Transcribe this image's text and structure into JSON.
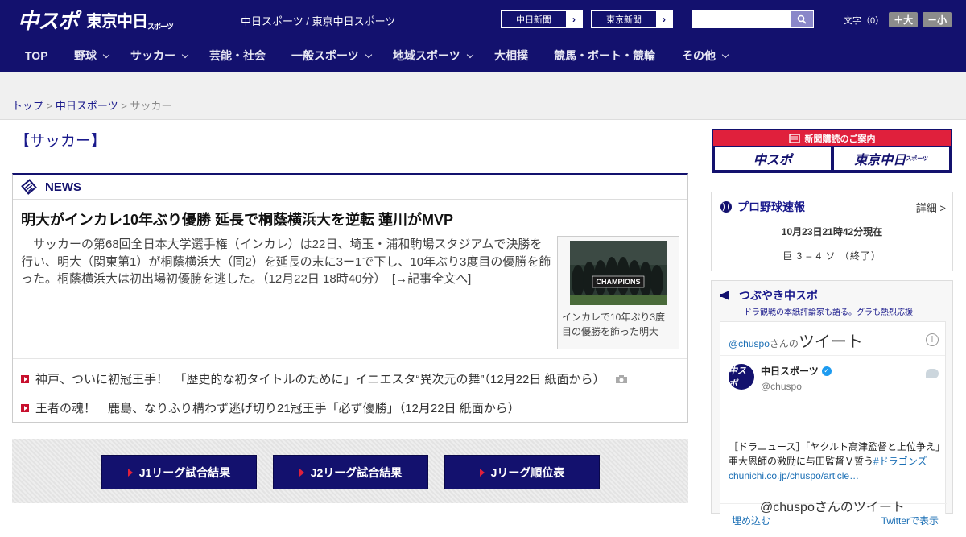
{
  "header": {
    "logo_main": "中スポ",
    "logo_tokyo": "東京中日",
    "logo_tokyo_small": "スポーツ",
    "site_title": "中日スポーツ / 東京中日スポーツ",
    "ext_links": [
      {
        "label": "中日新聞",
        "arrow": "›"
      },
      {
        "label": "東京新聞",
        "arrow": "›"
      }
    ],
    "search": {
      "placeholder": "",
      "value": "",
      "icon": "search-icon"
    },
    "font_size": {
      "label": "文字（0）",
      "bigger": "＋大",
      "smaller": "－小"
    }
  },
  "nav": {
    "items": [
      {
        "label": "TOP",
        "has_dropdown": false
      },
      {
        "label": "野球",
        "has_dropdown": true
      },
      {
        "label": "サッカー",
        "has_dropdown": true
      },
      {
        "label": "芸能・社会",
        "has_dropdown": false
      },
      {
        "label": "一般スポーツ",
        "has_dropdown": true
      },
      {
        "label": "地域スポーツ",
        "has_dropdown": true
      },
      {
        "label": "大相撲",
        "has_dropdown": false
      },
      {
        "label": "競馬・ボート・競輪",
        "has_dropdown": false
      },
      {
        "label": "その他",
        "has_dropdown": true
      }
    ]
  },
  "breadcrumb": {
    "items": [
      "トップ",
      "中日スポーツ",
      "サッカー"
    ],
    "separator": ">"
  },
  "page_title": "【サッカー】",
  "news": {
    "heading": "NEWS",
    "headline": "明大がインカレ10年ぶり優勝 延長で桐蔭横浜大を逆転 蓮川がMVP",
    "lead": "サッカーの第68回全日本大学選手権（インカレ）は22日、埼玉・浦和駒場スタジアムで決勝を行い、明大（関東第1）が桐蔭横浜大（同2）を延長の末に3ー1で下し、10年ぶり3度目の優勝を飾った。桐蔭横浜大は初出場初優勝を逃した。（12月22日 18時40分）　[→記事全文へ]",
    "photo_caption": "インカレで10年ぶり3度目の優勝を飾った明大",
    "photo_banner": "CHAMPIONS",
    "sub_items": [
      {
        "text": "神戸、ついに初冠王手！　「歴史的な初タイトルのために」イニエスタ“異次元の舞”（12月22日 紙面から）",
        "has_photo_icon": true
      },
      {
        "text": "王者の魂！　鹿島、なりふり構わず逃げ切り21冠王手「必ず優勝」（12月22日 紙面から）",
        "has_photo_icon": false
      }
    ]
  },
  "jleague_buttons": [
    "J1リーグ試合結果",
    "J2リーグ試合結果",
    "Jリーグ順位表"
  ],
  "sidebar": {
    "subscribe": {
      "title": "新聞購読のご案内",
      "logos": [
        "中スポ",
        "東京中日"
      ],
      "logo_small": "スポーツ"
    },
    "pro_baseball": {
      "title": "プロ野球速報",
      "more": "詳細 >",
      "time": "10月23日21時42分現在",
      "score": "巨 3 – 4 ソ （終了）"
    },
    "tweets": {
      "title": "つぶやき中スポ",
      "subtitle": "ドラ観戦の本紙評論家も語る。グラも熱烈応援",
      "handle_prefix": "@chuspo",
      "handle_suffix": "さんの",
      "tweets_label": "ツイート",
      "info": "i",
      "account_name": "中日スポーツ",
      "account_handle": "@chuspo",
      "avatar_text": "中スポ",
      "tweet_text": "［ドラニュース］「ヤクルト高津監督と上位争え」亜大恩師の激励に与田監督Ｖ誓う",
      "tweet_hashtag": "#ドラゴンズ",
      "tweet_link": "chunichi.co.jp/chuspo/article…",
      "embed": "埋め込む",
      "view_on_twitter": "Twitterで表示",
      "footer_heading": "@chuspoさんのツイート"
    }
  },
  "colors": {
    "brand_navy": "#13116e",
    "accent_red": "#e0203c",
    "link_blue": "#1a1a8c"
  }
}
